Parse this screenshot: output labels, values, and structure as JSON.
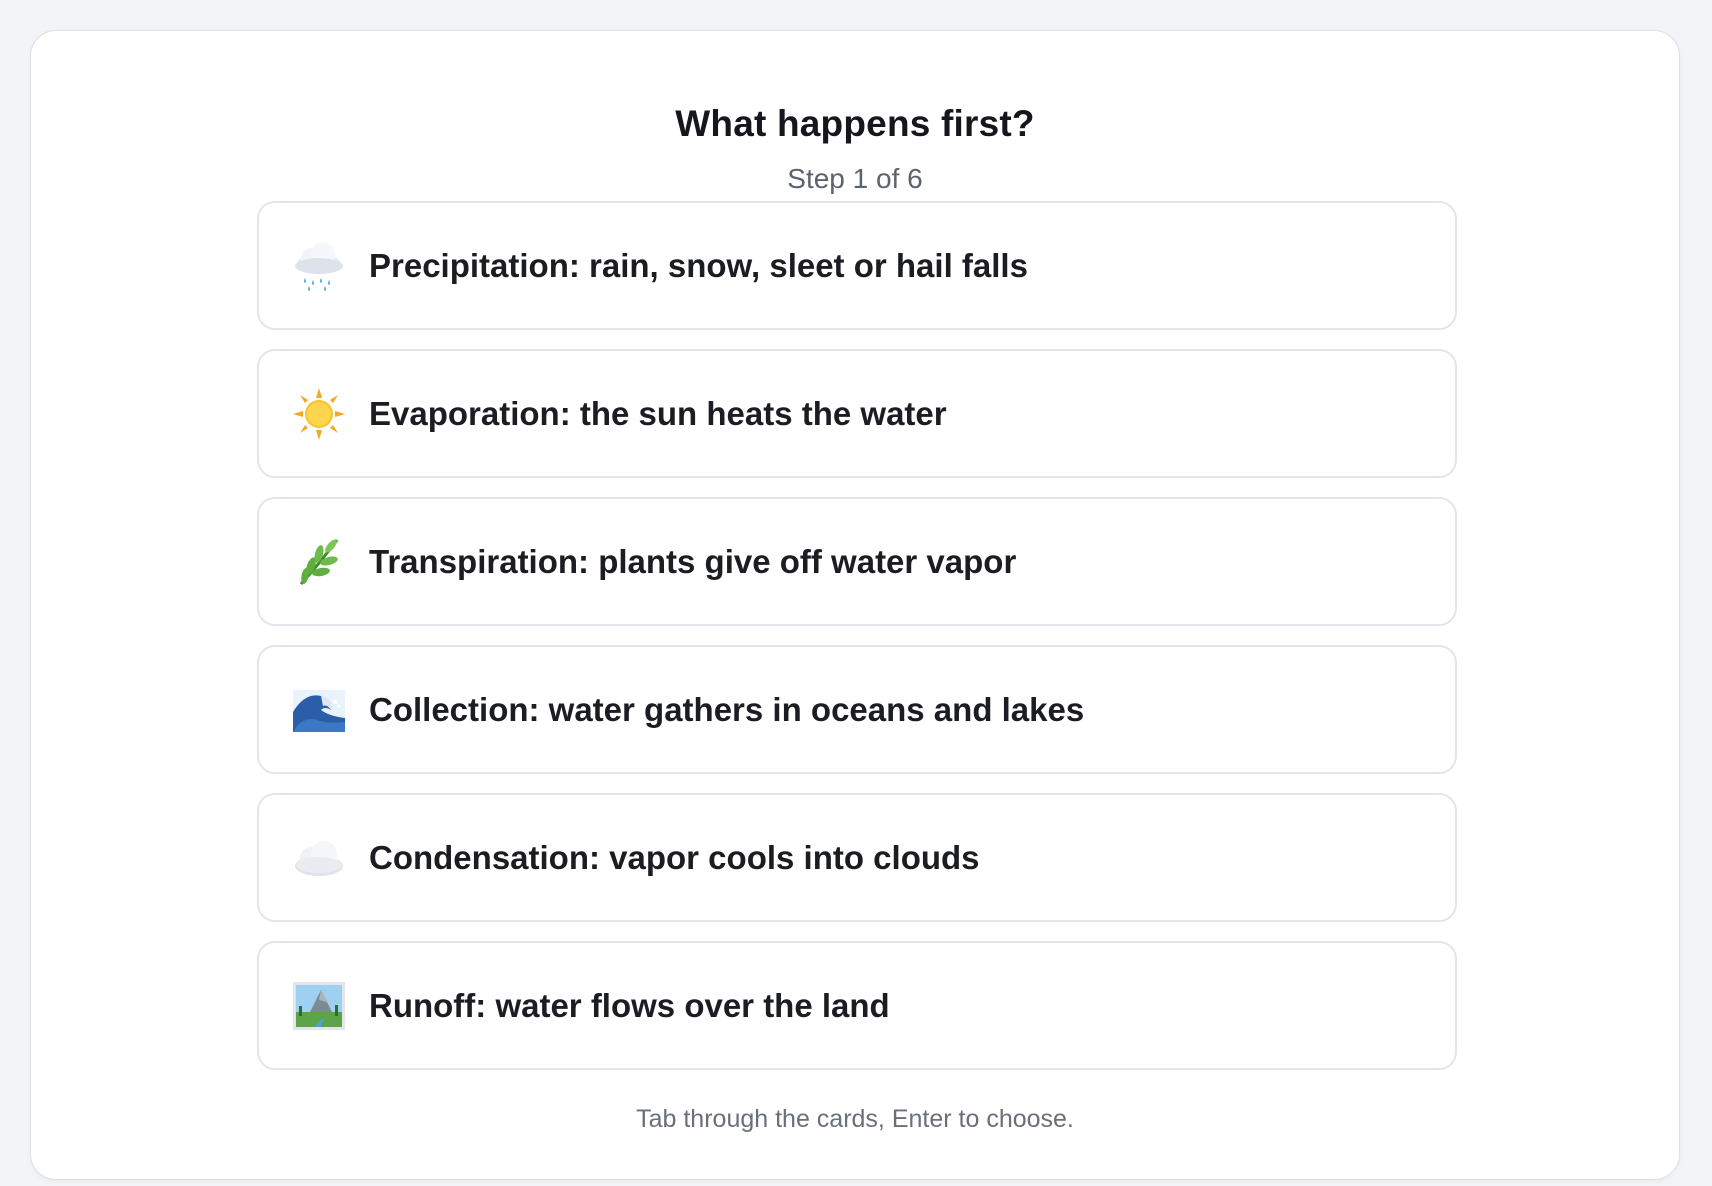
{
  "question": {
    "title": "What happens first?",
    "progress": "Step 1 of 6"
  },
  "cards": [
    {
      "icon": "rain-cloud-icon",
      "label": "Precipitation: rain, snow, sleet or hail falls"
    },
    {
      "icon": "sun-icon",
      "label": "Evaporation: the sun heats the water"
    },
    {
      "icon": "herb-icon",
      "label": "Transpiration: plants give off water vapor"
    },
    {
      "icon": "wave-icon",
      "label": "Collection: water gathers in oceans and lakes"
    },
    {
      "icon": "cloud-icon",
      "label": "Condensation: vapor cools into clouds"
    },
    {
      "icon": "landscape-icon",
      "label": "Runoff: water flows over the land"
    }
  ],
  "footer": {
    "hint": "Tab through the cards, Enter to choose."
  }
}
